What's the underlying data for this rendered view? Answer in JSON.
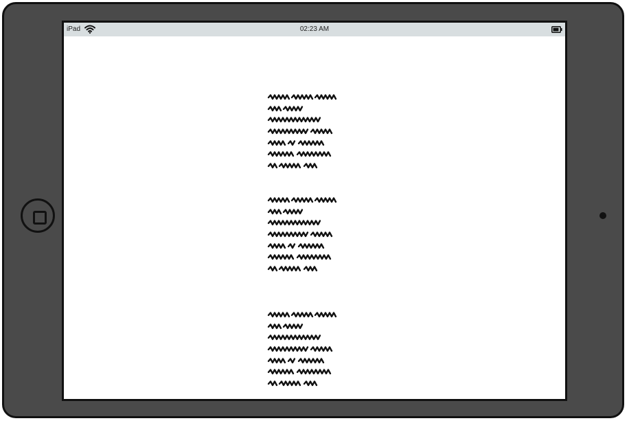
{
  "status_bar": {
    "carrier": "iPad",
    "time": "02:23 AM",
    "wifi_icon": "wifi-icon",
    "battery_icon": "battery-icon"
  },
  "device": {
    "home_button_icon": "home-button-icon",
    "camera_icon": "camera-dot-icon"
  },
  "content": {
    "blocks": [
      {
        "lines": 7
      },
      {
        "lines": 7
      },
      {
        "lines": 7
      }
    ]
  }
}
